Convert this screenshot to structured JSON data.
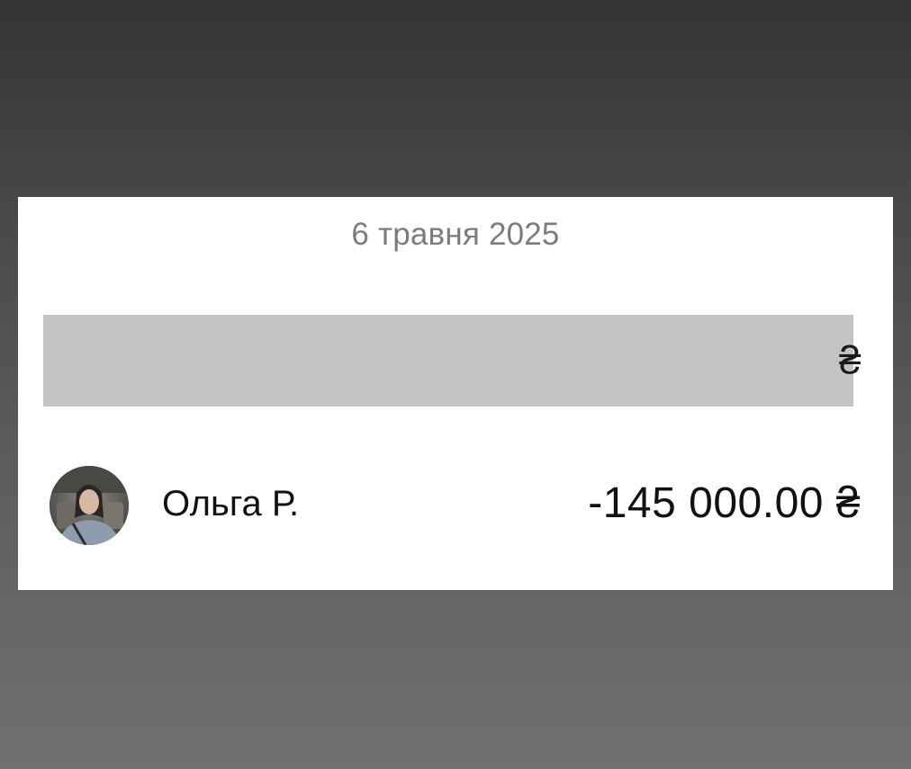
{
  "date_header": "6 травня 2025",
  "redacted_row": {
    "currency_partial": "₴"
  },
  "transaction": {
    "name": "Ольга Р.",
    "amount": "-145 000.00 ₴"
  }
}
